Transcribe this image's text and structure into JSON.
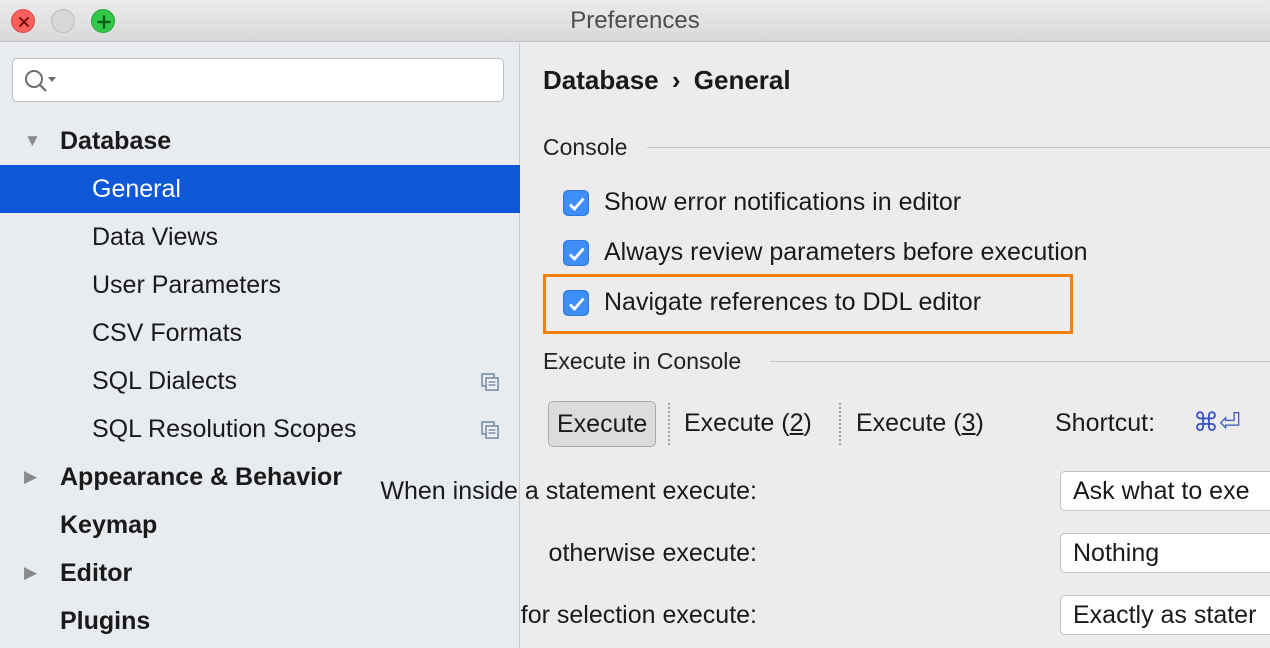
{
  "window": {
    "title": "Preferences"
  },
  "search": {
    "placeholder": "",
    "value": ""
  },
  "sidebar": {
    "items": [
      {
        "label": "Database"
      },
      {
        "label": "General"
      },
      {
        "label": "Data Views"
      },
      {
        "label": "User Parameters"
      },
      {
        "label": "CSV Formats"
      },
      {
        "label": "SQL Dialects"
      },
      {
        "label": "SQL Resolution Scopes"
      },
      {
        "label": "Appearance & Behavior"
      },
      {
        "label": "Keymap"
      },
      {
        "label": "Editor"
      },
      {
        "label": "Plugins"
      }
    ],
    "selected": "General"
  },
  "main": {
    "breadcrumb": {
      "root": "Database",
      "separator": "›",
      "leaf": "General"
    },
    "console": {
      "title": "Console",
      "options": [
        {
          "label": "Show error notifications in editor",
          "checked": true
        },
        {
          "label": "Always review parameters before execution",
          "checked": true
        },
        {
          "label": "Navigate references to DDL editor",
          "checked": true
        }
      ]
    },
    "execute": {
      "title": "Execute in Console",
      "buttons": [
        {
          "label": "Execute"
        },
        {
          "prefix": "Execute (",
          "mnemonic": "2",
          "suffix": ")"
        },
        {
          "prefix": "Execute (",
          "mnemonic": "3",
          "suffix": ")"
        }
      ],
      "shortcut_label": "Shortcut:",
      "shortcut_value": "⌘⏎",
      "rows": [
        {
          "label": "When inside a statement execute:",
          "value": "Ask what to exe"
        },
        {
          "label": "otherwise execute:",
          "value": "Nothing"
        },
        {
          "label": "for selection execute:",
          "value": "Exactly as stater"
        }
      ]
    }
  },
  "colors": {
    "selection": "#0e57d6",
    "highlight": "#f3800c",
    "checkbox": "#3e8ef7"
  }
}
